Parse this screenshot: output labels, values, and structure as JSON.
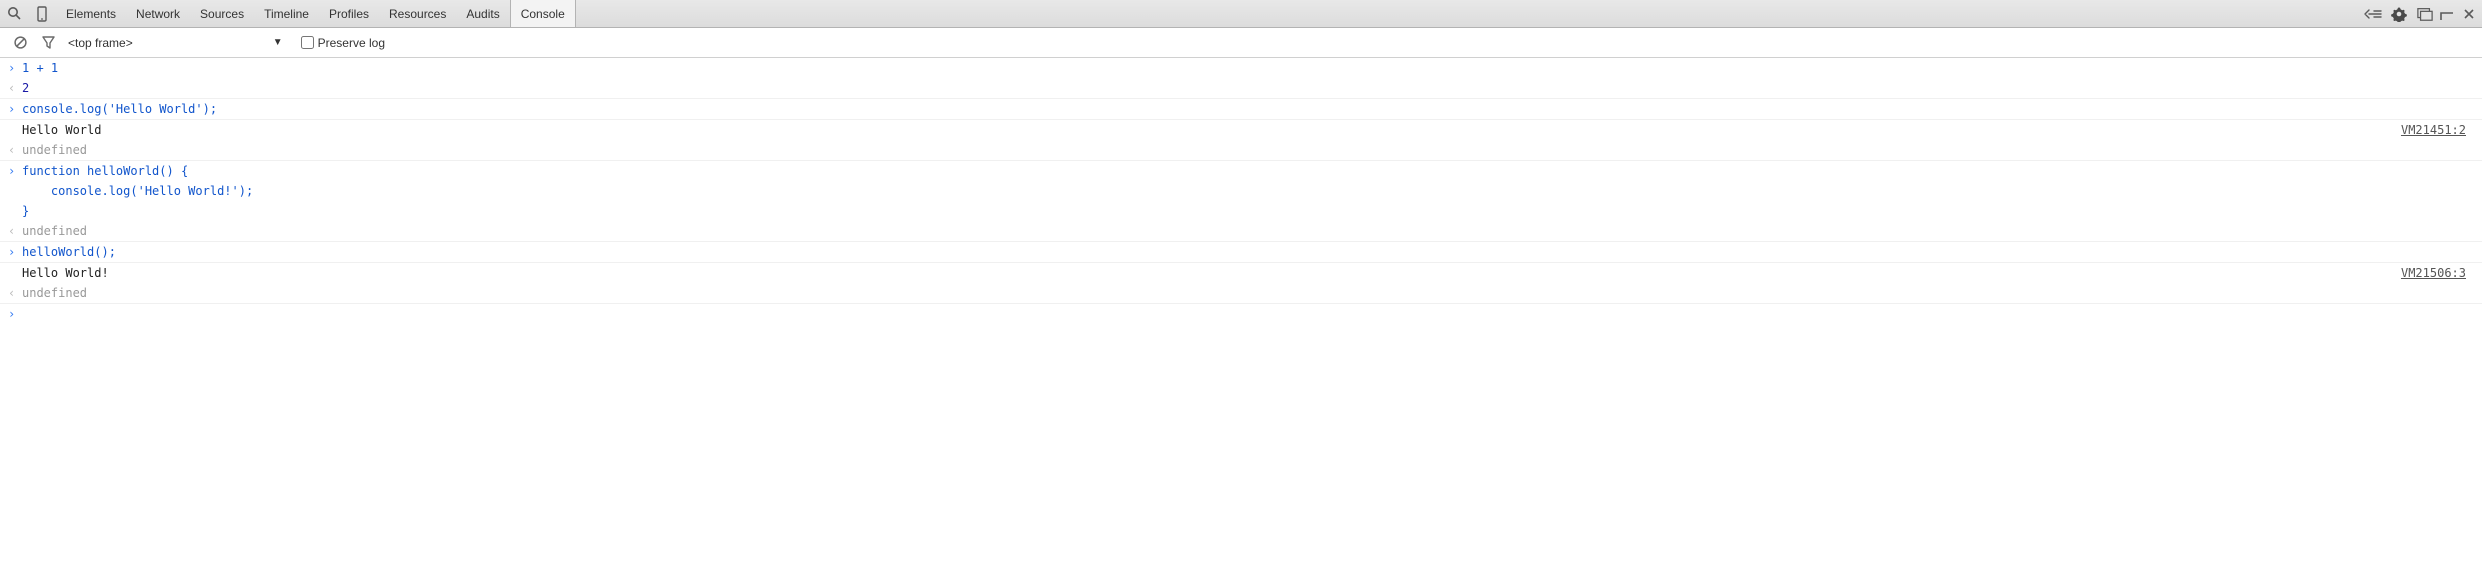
{
  "toolbar": {
    "tabs": [
      "Elements",
      "Network",
      "Sources",
      "Timeline",
      "Profiles",
      "Resources",
      "Audits",
      "Console"
    ],
    "active_tab_index": 7
  },
  "subbar": {
    "frame_selector": "<top frame>",
    "preserve_log_label": "Preserve log",
    "preserve_log_checked": false
  },
  "console": {
    "entries": [
      {
        "kind": "input",
        "text": "1 + 1"
      },
      {
        "kind": "result",
        "text": "2"
      },
      {
        "kind": "input",
        "text": "console.log('Hello World');"
      },
      {
        "kind": "log",
        "text": "Hello World",
        "source": "VM21451:2"
      },
      {
        "kind": "result",
        "text": "undefined"
      },
      {
        "kind": "input",
        "text": "function helloWorld() {\n    console.log('Hello World!');\n}"
      },
      {
        "kind": "result",
        "text": "undefined"
      },
      {
        "kind": "input",
        "text": "helloWorld();"
      },
      {
        "kind": "log",
        "text": "Hello World!",
        "source": "VM21506:3"
      },
      {
        "kind": "result",
        "text": "undefined"
      }
    ]
  }
}
